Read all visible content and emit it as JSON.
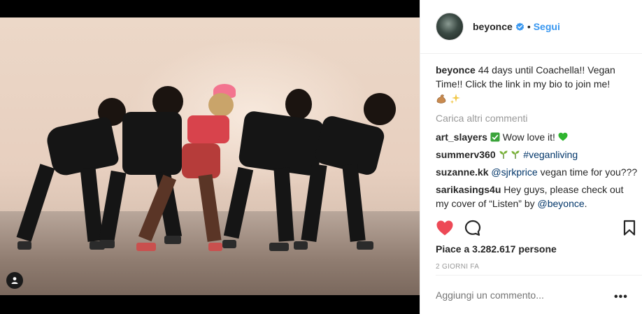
{
  "post": {
    "author": {
      "username": "beyonce",
      "verified": true,
      "follow_label": "Segui",
      "separator": "•"
    },
    "caption": {
      "username": "beyonce",
      "text": "44 days until Coachella!! Vegan Time!! Click the link in my bio to join me!",
      "emojis": [
        "flexed-biceps-icon",
        "sparkles-icon"
      ]
    },
    "load_more_label": "Carica altri commenti",
    "comments": [
      {
        "username": "art_slayers",
        "text": "Wow love it!",
        "emojis": [
          "check-mark-icon",
          "green-heart-icon"
        ]
      },
      {
        "username": "summerv360",
        "text": "#veganliving",
        "emojis": [
          "seedling-icon",
          "seedling-icon"
        ]
      },
      {
        "username": "suzanne.kk",
        "mention": "@sjrkprice",
        "text": "vegan time for you???"
      },
      {
        "username": "sarikasings4u",
        "text": "Hey guys, please check out my cover of “Listen” by",
        "mention": "@beyonce",
        "suffix": "."
      }
    ],
    "likes_label": "Piace a 3.282.617 persone",
    "timestamp": "2 GIORNI FA",
    "comment_placeholder": "Aggiungi un commento...",
    "more_label": "•••"
  },
  "colors": {
    "link": "#3897f0",
    "like_red": "#ed4956",
    "mention": "#003569",
    "muted": "#999999"
  }
}
